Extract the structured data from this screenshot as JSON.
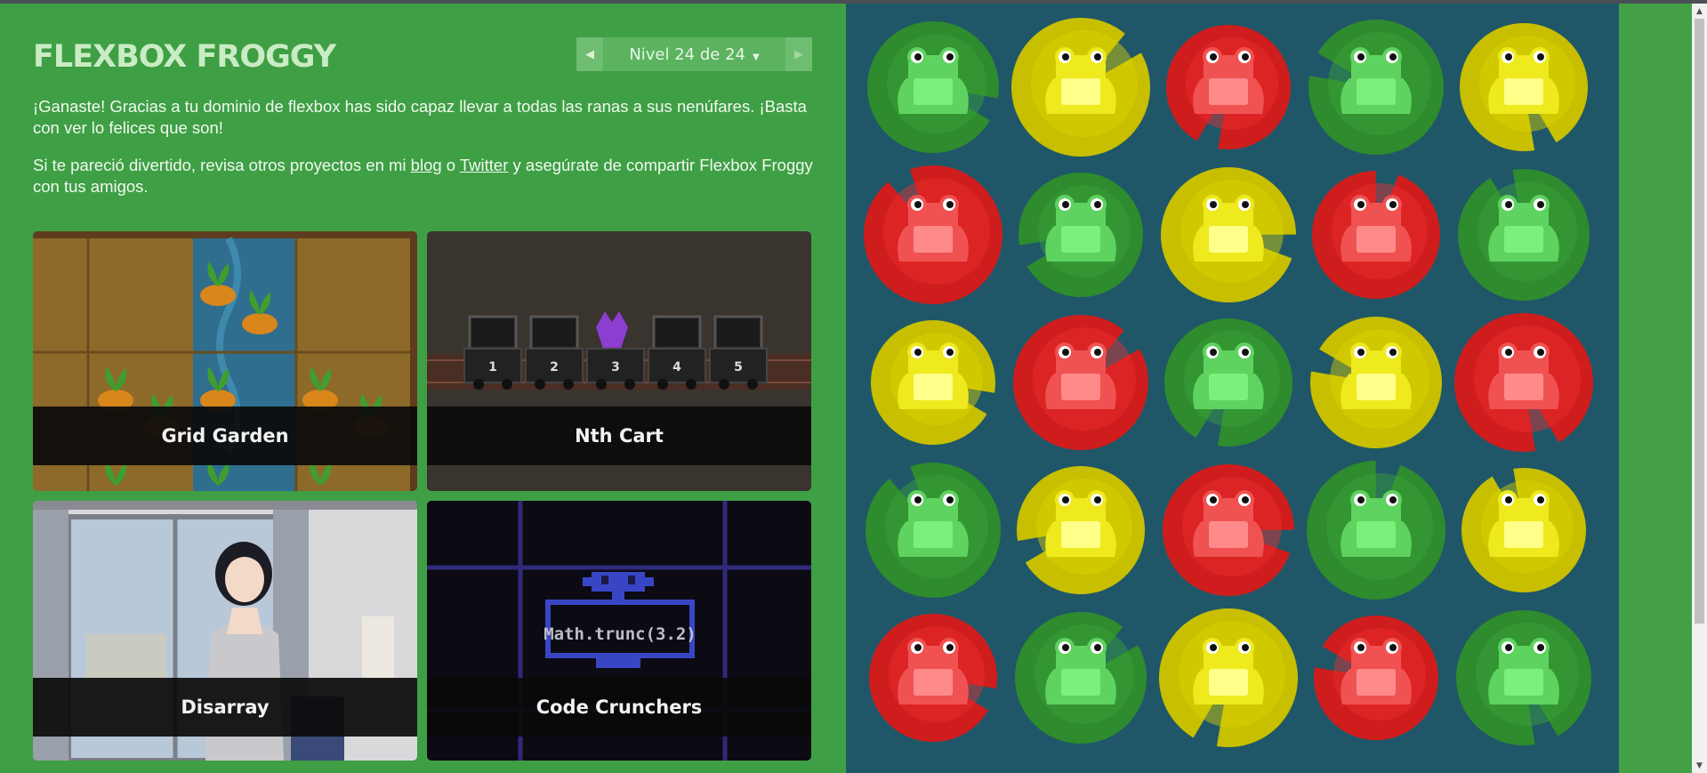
{
  "app": {
    "title": "FLEXBOX FROGGY"
  },
  "level_nav": {
    "prev": "◀",
    "indicator": "Nivel 24 de 24",
    "caret": "▼",
    "next": "▶"
  },
  "content": {
    "p1": "¡Ganaste! Gracias a tu dominio de flexbox has sido capaz llevar a todas las ranas a sus nenúfares. ¡Basta con ver lo felices que son!",
    "p2_before": "Si te pareció divertido, revisa otros proyectos en mi ",
    "link_blog": "blog",
    "p2_mid": " o ",
    "link_twitter": "Twitter",
    "p2_after": " y asegúrate de compartir Flexbox Froggy con tus amigos."
  },
  "cards": [
    {
      "title": "Grid Garden"
    },
    {
      "title": "Nth Cart"
    },
    {
      "title": "Disarray"
    },
    {
      "title": "Code Crunchers"
    }
  ],
  "nth_cart_numbers": [
    "1",
    "2",
    "3",
    "4",
    "5"
  ],
  "code_crunchers_code": "Math.trunc(3.2)",
  "pond": {
    "rows": [
      [
        "green",
        "yellow",
        "red",
        "green",
        "yellow"
      ],
      [
        "red",
        "green",
        "yellow",
        "red",
        "green"
      ],
      [
        "yellow",
        "red",
        "green",
        "yellow",
        "red"
      ],
      [
        "green",
        "yellow",
        "red",
        "green",
        "yellow"
      ],
      [
        "red",
        "green",
        "yellow",
        "red",
        "green"
      ]
    ]
  },
  "colors": {
    "background": "#43a047",
    "pond": "#1f5768",
    "green": "#2e8b2e",
    "yellow": "#cdc500",
    "red": "#d41f1f"
  },
  "scrollbar": {
    "up": "▲",
    "down": "▼"
  }
}
